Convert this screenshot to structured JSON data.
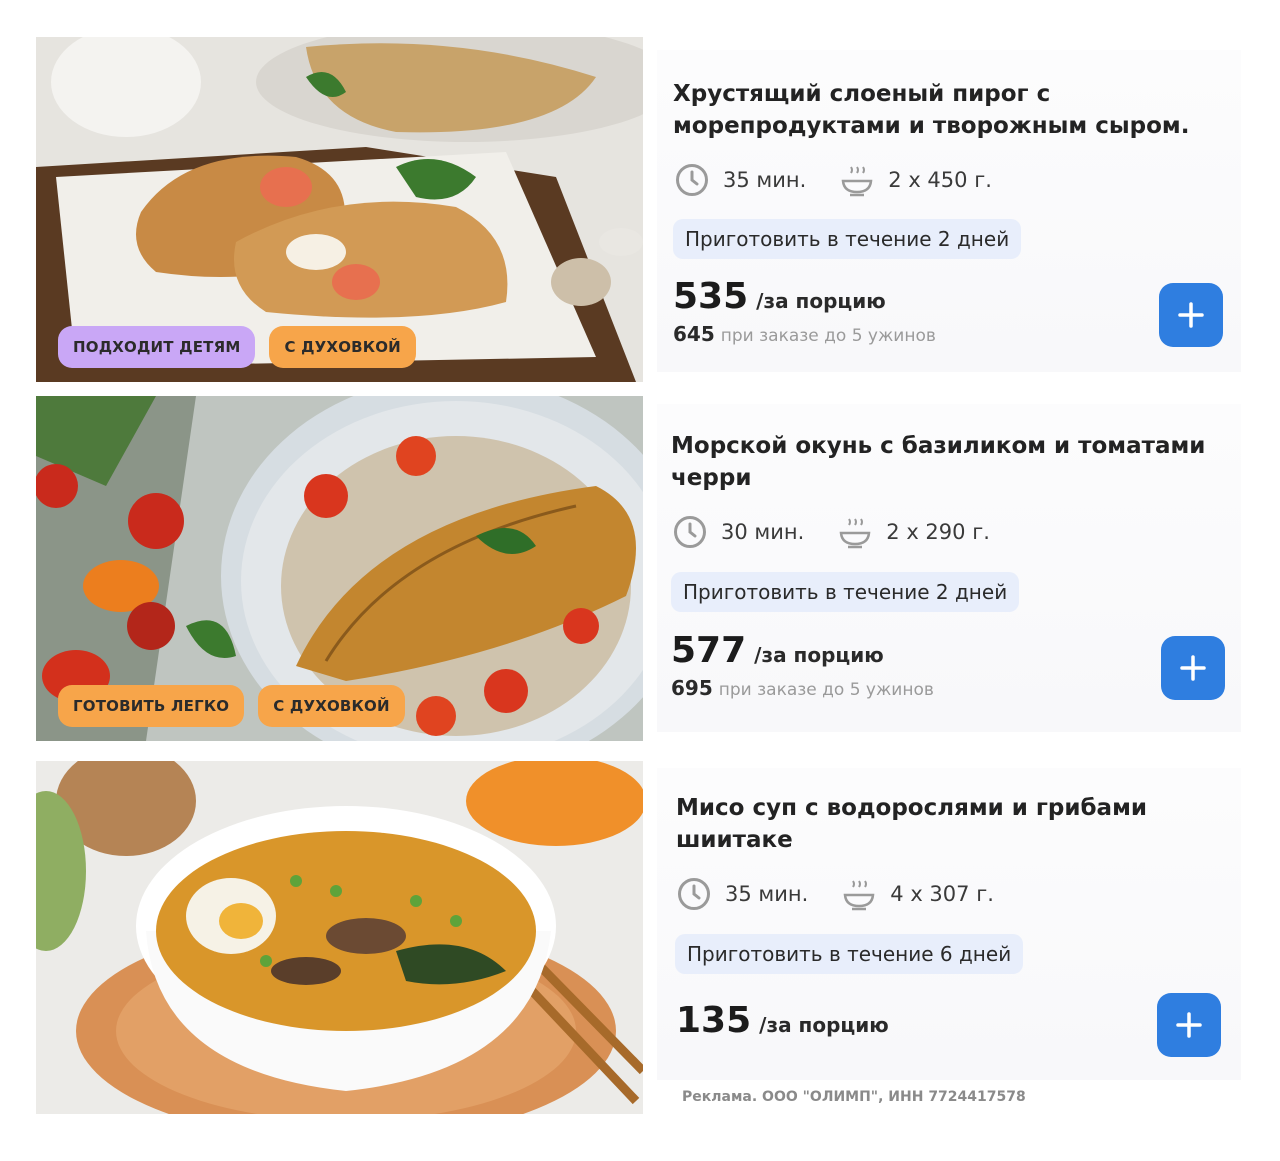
{
  "products": [
    {
      "title": "Хрустящий слоеный пирог с морепродуктами и творожным сыром.",
      "time": "35 мин.",
      "portion": "2 х 450 г.",
      "cook_within": "Приготовить в течение 2 дней",
      "price": "535",
      "price_unit": "/за порцию",
      "alt_price": "645",
      "alt_price_note": "при заказе до 5 ужинов",
      "tags": [
        "ПОДХОДИТ ДЕТЯМ",
        "С ДУХОВКОЙ"
      ],
      "image_subject": "seafood puff pastry pie with shrimp"
    },
    {
      "title": "Морской окунь с базиликом и томатами черри",
      "time": "30 мин.",
      "portion": "2 х 290 г.",
      "cook_within": "Приготовить в течение 2 дней",
      "price": "577",
      "price_unit": "/за порцию",
      "alt_price": "695",
      "alt_price_note": "при заказе до 5 ужинов",
      "tags": [
        "ГОТОВИТЬ ЛЕГКО",
        "С ДУХОВКОЙ"
      ],
      "image_subject": "sea bass fillet on rice with cherry tomatoes and basil"
    },
    {
      "title": "Мисо суп с водорослями и грибами шиитаке",
      "time": "35 мин.",
      "portion": "4 х 307 г.",
      "cook_within": "Приготовить в течение 6 дней",
      "price": "135",
      "price_unit": "/за порцию",
      "tags": [],
      "image_subject": "miso soup bowl with egg, shiitake and seaweed"
    }
  ],
  "ad_disclaimer": "Реклама. ООО \"ОЛИМП\", ИНН 7724417578",
  "icons": {
    "time": "clock-icon",
    "portion": "bowl-icon",
    "add": "plus-icon"
  },
  "colors": {
    "accent": "#2f7ee0",
    "pill_bg": "#e8eefb",
    "tag_purple": "#c9a7f6",
    "tag_orange": "#f7a54a"
  }
}
